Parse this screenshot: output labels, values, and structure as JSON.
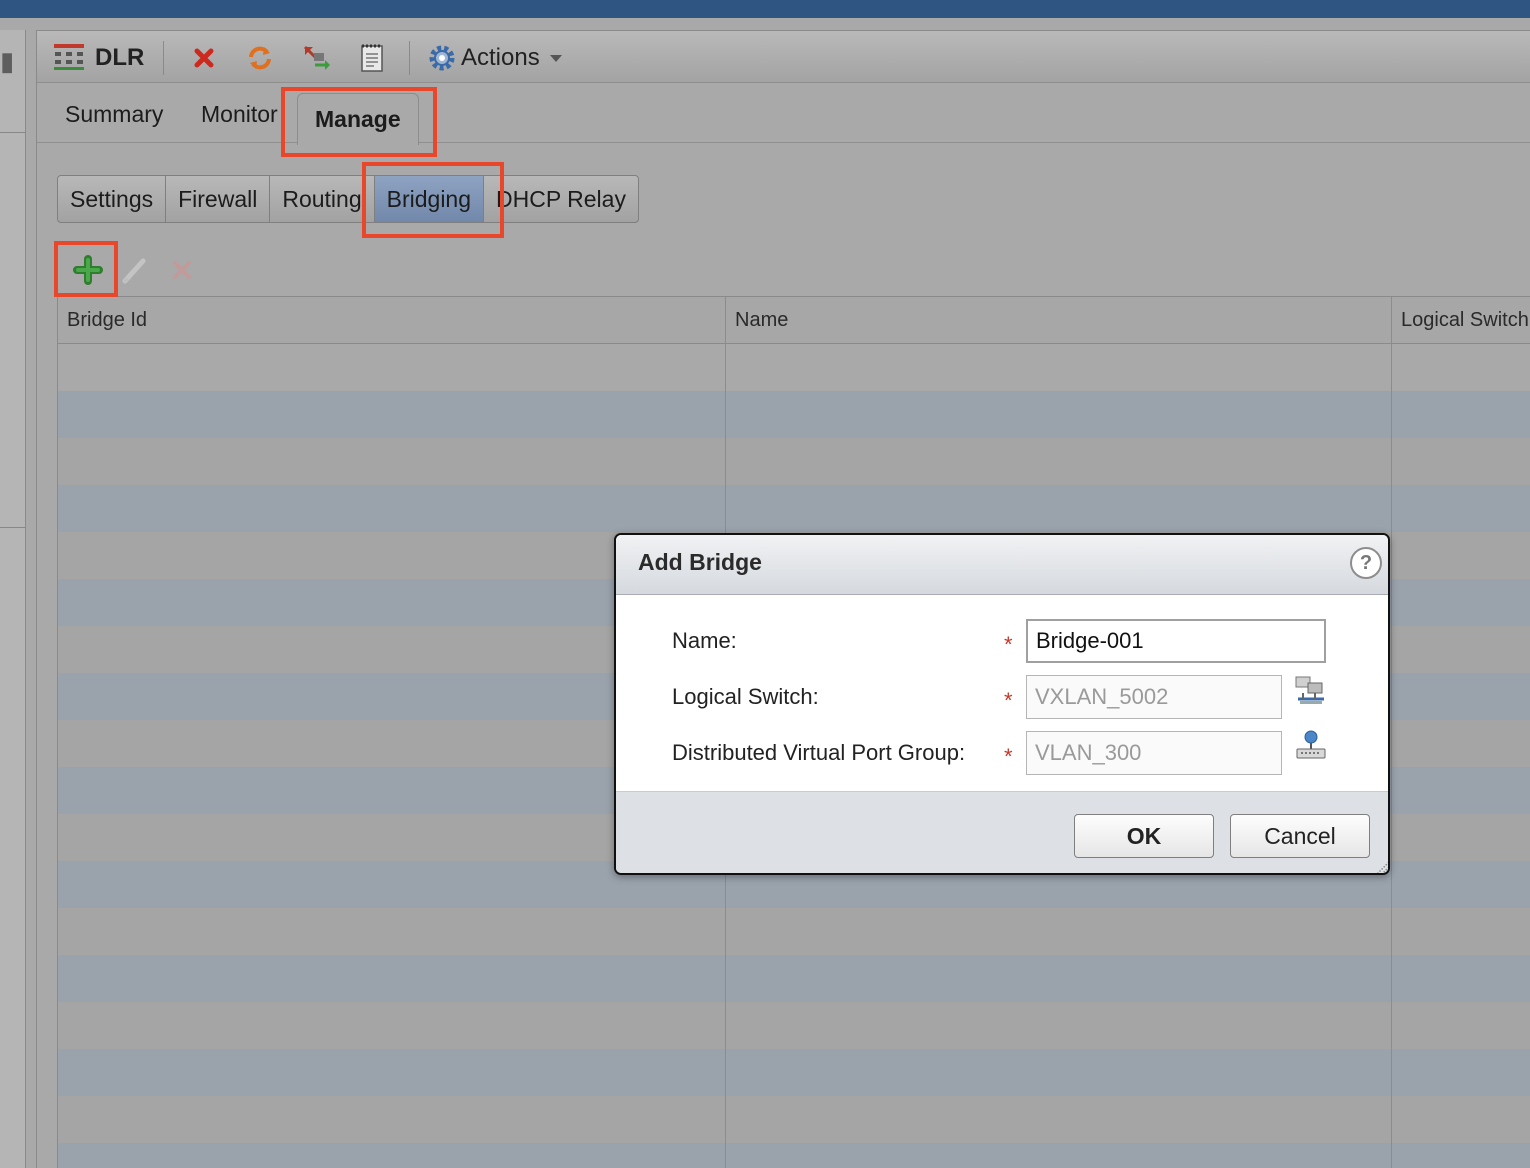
{
  "toolbar": {
    "object_icon": "dlr-router-icon",
    "object_name": "DLR",
    "actions_label": "Actions",
    "icons": [
      "delete-icon",
      "refresh-icon",
      "migrate-icon",
      "notes-icon",
      "gear-icon"
    ]
  },
  "tabs": [
    {
      "label": "Summary"
    },
    {
      "label": "Monitor"
    },
    {
      "label": "Manage",
      "active": true
    }
  ],
  "subtabs": [
    {
      "label": "Settings"
    },
    {
      "label": "Firewall"
    },
    {
      "label": "Routing"
    },
    {
      "label": "Bridging",
      "active": true
    },
    {
      "label": "DHCP Relay"
    }
  ],
  "grid": {
    "toolbar_icons": [
      "add-icon",
      "edit-icon",
      "delete-icon"
    ],
    "columns": [
      "Bridge Id",
      "Name",
      "Logical Switch"
    ],
    "rows": []
  },
  "dialog": {
    "title": "Add Bridge",
    "help_glyph": "?",
    "fields": [
      {
        "label": "Name:",
        "required": true,
        "value": "Bridge-001"
      },
      {
        "label": "Logical Switch:",
        "required": true,
        "value": "VXLAN_5002"
      },
      {
        "label": "Distributed Virtual Port Group:",
        "required": true,
        "value": "VLAN_300"
      }
    ],
    "required_marker": "*",
    "ok_label": "OK",
    "cancel_label": "Cancel"
  },
  "colors": {
    "highlight": "#e8472b",
    "active_subtab": "#7f93b4",
    "required": "#c8372a"
  }
}
